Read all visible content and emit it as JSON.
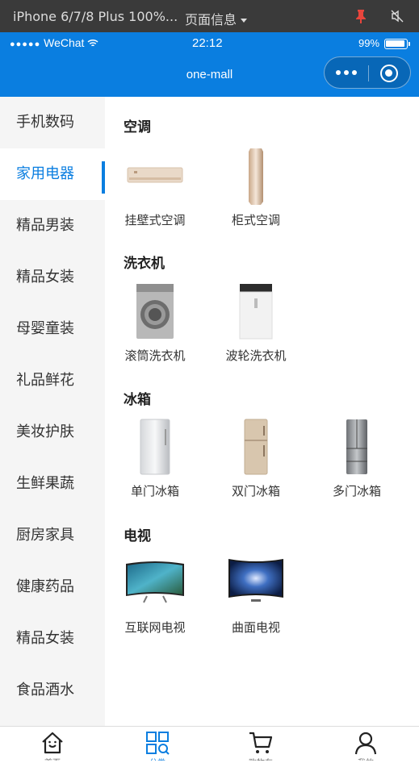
{
  "devtools": {
    "device": "iPhone 6/7/8 Plus 100%...",
    "page_info": "页面信息",
    "icons": [
      "pin-icon",
      "mute-icon"
    ]
  },
  "status_bar": {
    "carrier": "WeChat",
    "signal_dots": "●●●●●",
    "time": "22:12",
    "battery": "99%"
  },
  "nav": {
    "title": "one-mall",
    "color": "#0a7ee0"
  },
  "sidebar": {
    "active_index": 1,
    "items": [
      {
        "label": "手机数码"
      },
      {
        "label": "家用电器"
      },
      {
        "label": "精品男装"
      },
      {
        "label": "精品女装"
      },
      {
        "label": "母婴童装"
      },
      {
        "label": "礼品鲜花"
      },
      {
        "label": "美妆护肤"
      },
      {
        "label": "生鲜果蔬"
      },
      {
        "label": "厨房家具"
      },
      {
        "label": "健康药品"
      },
      {
        "label": "精品女装"
      },
      {
        "label": "食品酒水"
      }
    ]
  },
  "sections": [
    {
      "title": "空调",
      "products": [
        {
          "label": "挂壁式空调",
          "icon": "wall-ac-icon"
        },
        {
          "label": "柜式空调",
          "icon": "tower-ac-icon"
        }
      ]
    },
    {
      "title": "洗衣机",
      "products": [
        {
          "label": "滚筒洗衣机",
          "icon": "front-load-washer-icon"
        },
        {
          "label": "波轮洗衣机",
          "icon": "top-load-washer-icon"
        }
      ]
    },
    {
      "title": "冰箱",
      "products": [
        {
          "label": "单门冰箱",
          "icon": "single-door-fridge-icon"
        },
        {
          "label": "双门冰箱",
          "icon": "double-door-fridge-icon"
        },
        {
          "label": "多门冰箱",
          "icon": "multi-door-fridge-icon"
        }
      ]
    },
    {
      "title": "电视",
      "products": [
        {
          "label": "互联网电视",
          "icon": "smart-tv-icon"
        },
        {
          "label": "曲面电视",
          "icon": "curved-tv-icon"
        }
      ]
    }
  ],
  "tabbar": {
    "active_index": 1,
    "tabs": [
      {
        "icon": "home-icon",
        "label": "首页"
      },
      {
        "icon": "category-icon",
        "label": "分类"
      },
      {
        "icon": "cart-icon",
        "label": "购物车"
      },
      {
        "icon": "user-icon",
        "label": "我的"
      }
    ]
  }
}
